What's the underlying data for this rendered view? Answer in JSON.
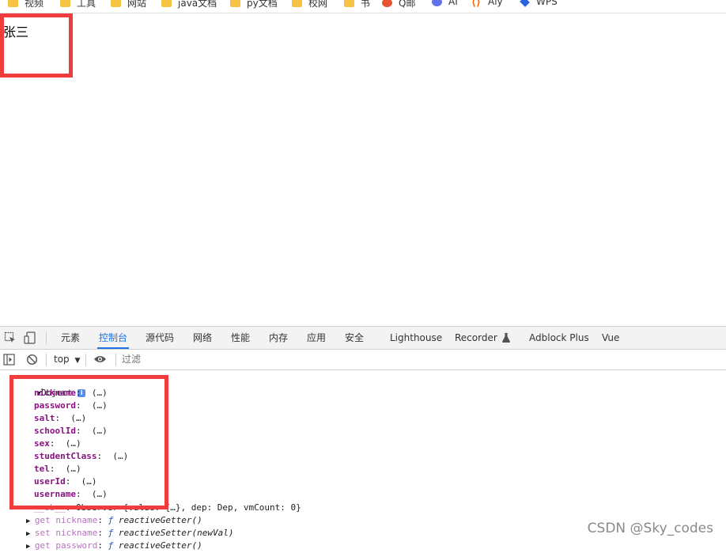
{
  "bookmarks": [
    {
      "label": "视频",
      "icon": "folder-icon"
    },
    {
      "label": "工具",
      "icon": "folder-icon"
    },
    {
      "label": "网站",
      "icon": "folder-icon"
    },
    {
      "label": "java文档",
      "icon": "folder-icon"
    },
    {
      "label": "py文档",
      "icon": "folder-icon"
    },
    {
      "label": "校网",
      "icon": "folder-icon"
    },
    {
      "label": "书",
      "icon": "folder-icon"
    },
    {
      "label": "Q邮",
      "icon": "qq-mail-icon"
    },
    {
      "label": "AI",
      "icon": "ai-icon"
    },
    {
      "label": "Aly",
      "icon": "aliyun-icon"
    },
    {
      "label": "WPS",
      "icon": "wps-icon"
    }
  ],
  "page": {
    "text": "张三"
  },
  "devtools": {
    "tabs": [
      "元素",
      "控制台",
      "源代码",
      "网络",
      "性能",
      "内存",
      "应用",
      "安全",
      "Lighthouse",
      "Recorder",
      "Adblock Plus",
      "Vue"
    ],
    "active_tab": "控制台",
    "icons": [
      "inspect-icon",
      "device-toolbar-icon",
      "flask-icon"
    ],
    "console_bar": {
      "context": "top",
      "filter_placeholder": "过滤",
      "icons": [
        "sidebar-toggle-icon",
        "clear-console-icon",
        "chevron-down-icon",
        "eye-icon"
      ]
    }
  },
  "console": {
    "object_label": "Object",
    "info_badge": "i",
    "properties": [
      {
        "key": "nickname",
        "value": "(…)"
      },
      {
        "key": "password",
        "value": "(…)"
      },
      {
        "key": "salt",
        "value": "(…)"
      },
      {
        "key": "schoolId",
        "value": "(…)"
      },
      {
        "key": "sex",
        "value": "(…)"
      },
      {
        "key": "studentClass",
        "value": "(…)"
      },
      {
        "key": "tel",
        "value": "(…)"
      },
      {
        "key": "userId",
        "value": "(…)"
      },
      {
        "key": "username",
        "value": "(…)"
      }
    ],
    "ob_line": {
      "key": "__ob__",
      "value": "Observer {value: {…}, dep: Dep, vmCount: 0}"
    },
    "accessors": [
      {
        "kind": "get",
        "name": "nickname",
        "fn": "reactiveGetter",
        "args": "()"
      },
      {
        "kind": "set",
        "name": "nickname",
        "fn": "reactiveSetter",
        "args": "(newVal)"
      },
      {
        "kind": "get",
        "name": "password",
        "fn": "reactiveGetter",
        "args": "()"
      }
    ]
  },
  "watermark": "CSDN @Sky_codes",
  "colors": {
    "annotation": "#f03c3c",
    "active_tab": "#1a73e8",
    "property_key": "#881280"
  }
}
